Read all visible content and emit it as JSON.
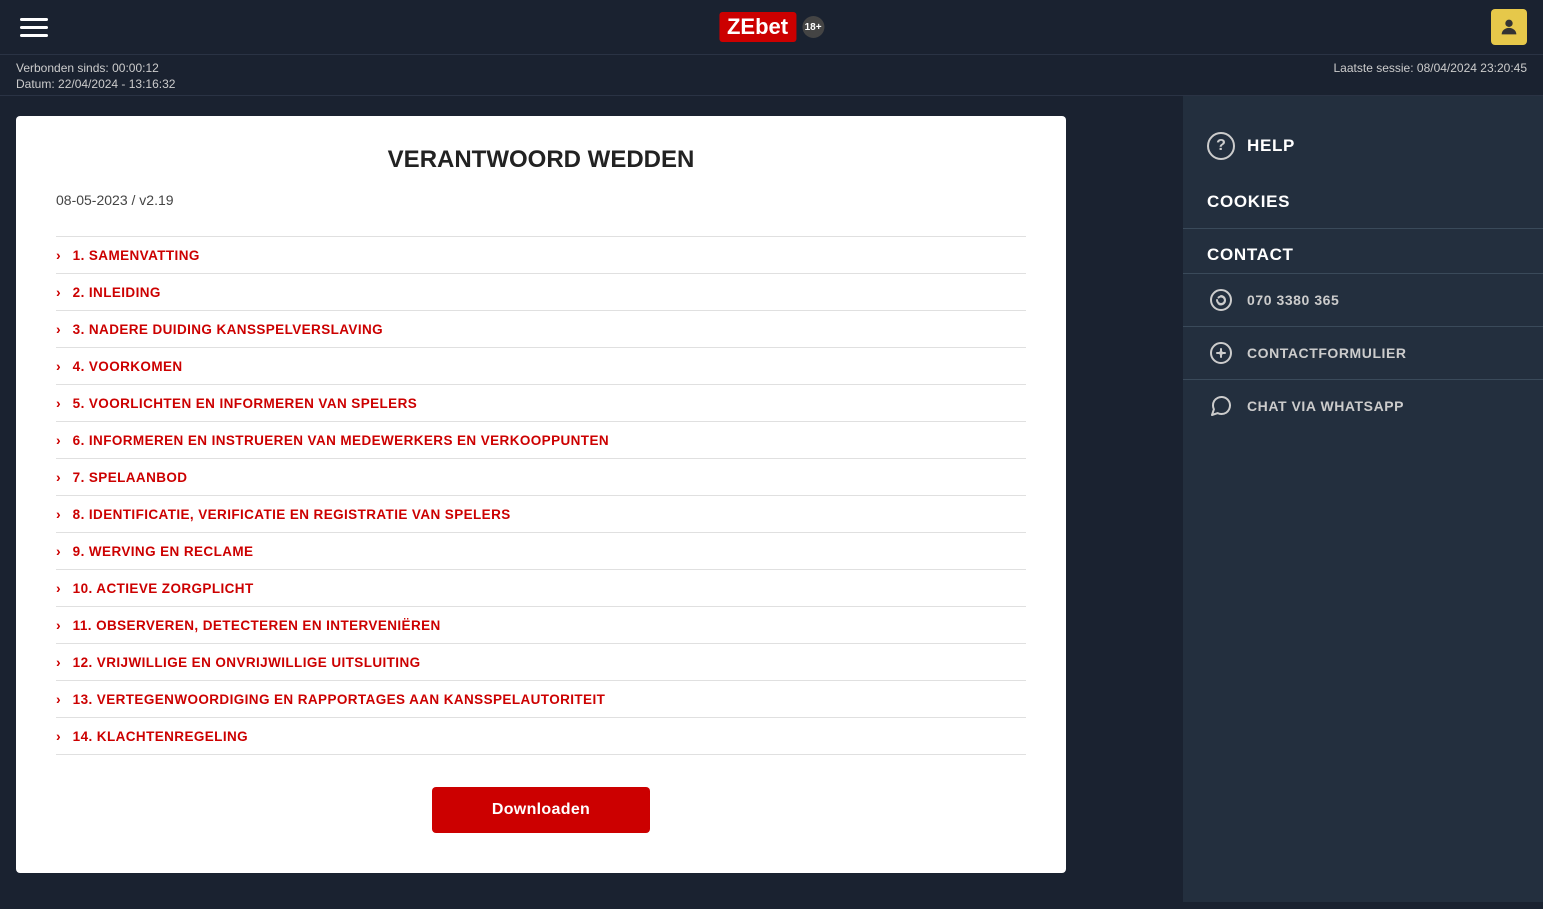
{
  "header": {
    "logo": "ZEbet",
    "logo_ze": "ZE",
    "logo_bet": "bet",
    "age": "18+",
    "hamburger_label": "Menu"
  },
  "statusbar": {
    "connected_label": "Verbonden sinds:",
    "connected_time": "00:00:12",
    "date_label": "Datum:",
    "date_value": "22/04/2024 - 13:16:32",
    "last_session_label": "Laatste sessie:",
    "last_session_value": "08/04/2024 23:20:45"
  },
  "document": {
    "title": "VERANTWOORD WEDDEN",
    "version": "08-05-2023 / v2.19",
    "sections": [
      {
        "number": "1.",
        "label": "SAMENVATTING"
      },
      {
        "number": "2.",
        "label": "INLEIDING"
      },
      {
        "number": "3.",
        "label": "NADERE DUIDING KANSSPELVERSLAVING"
      },
      {
        "number": "4.",
        "label": "VOORKOMEN"
      },
      {
        "number": "5.",
        "label": "VOORLICHTEN EN INFORMEREN VAN SPELERS"
      },
      {
        "number": "6.",
        "label": "INFORMEREN EN INSTRUEREN VAN MEDEWERKERS EN VERKOOPPUNTEN"
      },
      {
        "number": "7.",
        "label": "SPELAANBOD"
      },
      {
        "number": "8.",
        "label": "IDENTIFICATIE, VERIFICATIE EN REGISTRATIE VAN SPELERS"
      },
      {
        "number": "9.",
        "label": "WERVING EN RECLAME"
      },
      {
        "number": "10.",
        "label": "ACTIEVE ZORGPLICHT"
      },
      {
        "number": "11.",
        "label": "OBSERVEREN, DETECTEREN EN INTERVENIËREN"
      },
      {
        "number": "12.",
        "label": "VRIJWILLIGE EN ONVRIJWILLIGE UITSLUITING"
      },
      {
        "number": "13.",
        "label": "VERTEGENWOORDIGING EN RAPPORTAGES AAN KANSSPELAUTORITEIT"
      },
      {
        "number": "14.",
        "label": "KLACHTENREGELING"
      }
    ],
    "download_button": "Downloaden"
  },
  "sidebar": {
    "help_label": "HELP",
    "cookies_label": "COOKIES",
    "contact_label": "CONTACT",
    "phone_number": "070 3380 365",
    "contact_form_label": "CONTACTFORMULIER",
    "whatsapp_label": "CHAT VIA WHATSAPP"
  }
}
